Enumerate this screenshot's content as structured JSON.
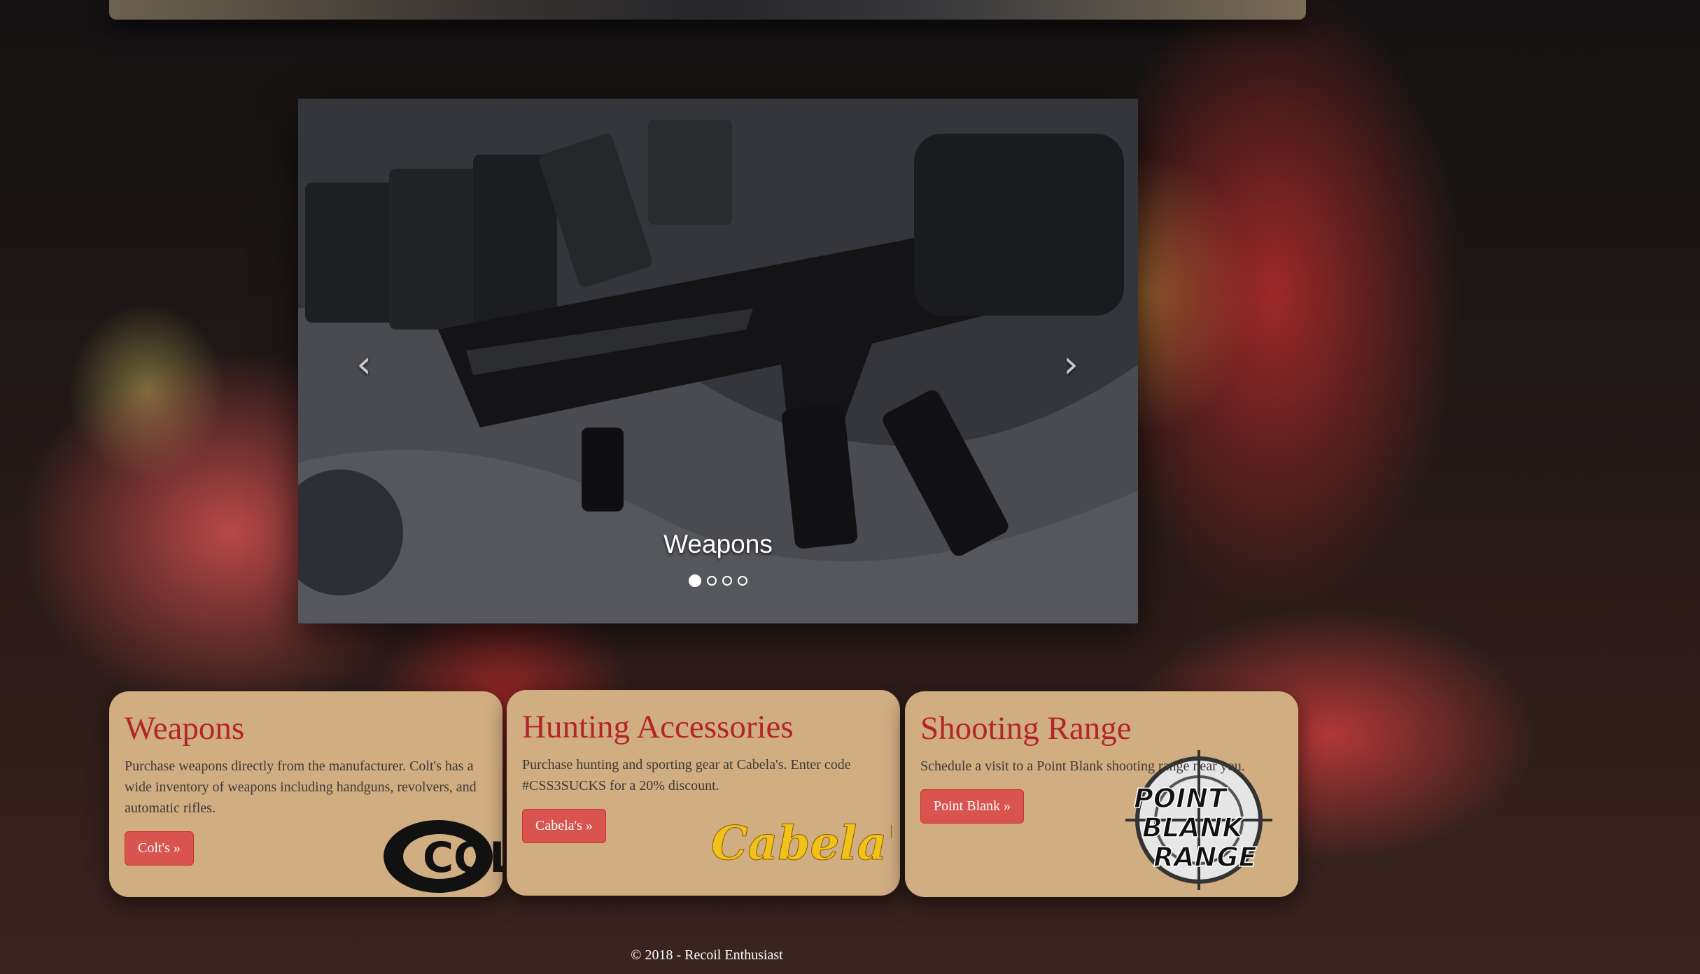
{
  "carousel": {
    "caption": "Weapons",
    "prev_icon": "chevron-left-icon",
    "next_icon": "chevron-right-icon",
    "prev_glyph": "‹",
    "next_glyph": "›",
    "slide_count": 4,
    "active_slide": 1
  },
  "cards": [
    {
      "title": "Weapons",
      "text": "Purchase weapons directly from the manufacturer. Colt's has a wide inventory of weapons including handguns, revolvers, and automatic rifles.",
      "button": "Colt's »",
      "logo": "COLT"
    },
    {
      "title": "Hunting Accessories",
      "text": "Purchase hunting and sporting gear at Cabela's. Enter code #CSS3SUCKS for a 20% discount.",
      "button": "Cabela's »",
      "logo": "Cabela's"
    },
    {
      "title": "Shooting Range",
      "text": "Schedule a visit to a Point Blank shooting range near you.",
      "button": "Point Blank »",
      "logo_lines": [
        "POINT",
        "BLANK",
        "RANGE"
      ]
    }
  ],
  "footer": {
    "text": "© 2018 - Recoil Enthusiast"
  },
  "colors": {
    "card_bg": "#d1ae82",
    "heading": "#b3252a",
    "button": "#d9534f",
    "cabelas_yellow": "#f2c21b"
  }
}
